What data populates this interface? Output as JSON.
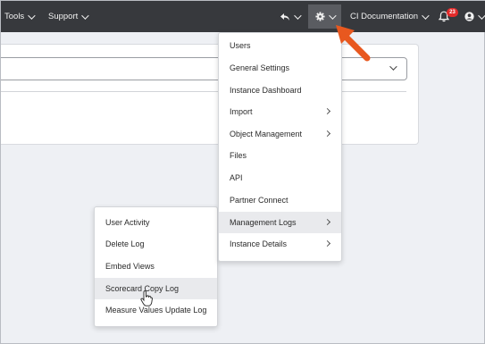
{
  "topbar": {
    "tools_label": "Tools",
    "support_label": "Support",
    "instance_label": "CI Documentation",
    "notification_count": "23"
  },
  "settings_menu": {
    "items": [
      {
        "label": "Users"
      },
      {
        "label": "General Settings"
      },
      {
        "label": "Instance Dashboard"
      },
      {
        "label": "Import"
      },
      {
        "label": "Object Management"
      },
      {
        "label": "Files"
      },
      {
        "label": "API"
      },
      {
        "label": "Partner Connect"
      },
      {
        "label": "Management Logs"
      },
      {
        "label": "Instance Details"
      }
    ]
  },
  "logs_menu": {
    "items": [
      {
        "label": "User Activity"
      },
      {
        "label": "Delete Log"
      },
      {
        "label": "Embed Views"
      },
      {
        "label": "Scorecard Copy Log"
      },
      {
        "label": "Measure Values Update Log"
      }
    ]
  },
  "colors": {
    "topbar": "#37393d",
    "annotation_arrow": "#e8581f",
    "badge": "#e32b2b"
  }
}
